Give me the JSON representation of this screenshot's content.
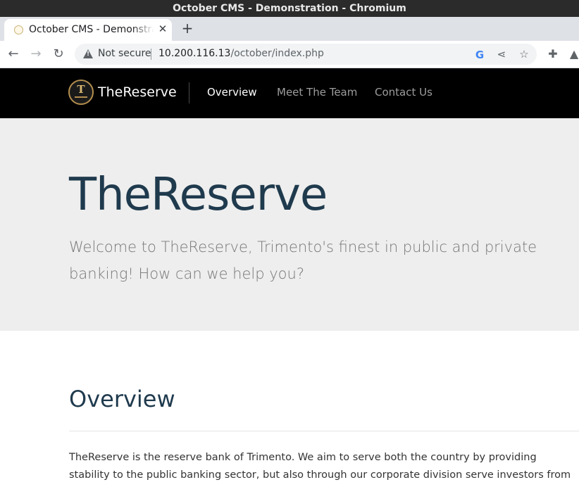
{
  "window": {
    "title": "October CMS - Demonstration - Chromium"
  },
  "tab": {
    "title": "October CMS - Demonstration",
    "close_icon": "close-icon"
  },
  "toolbar": {
    "security_label": "Not secure",
    "url_host": "10.200.116.13",
    "url_path": "/october/index.php"
  },
  "site": {
    "brand": "TheReserve",
    "nav": [
      "Overview",
      "Meet The Team",
      "Contact Us"
    ]
  },
  "hero": {
    "title": "TheReserve",
    "subtitle": "Welcome to TheReserve, Trimento's finest in public and private banking! How can we help you?"
  },
  "overview": {
    "title": "Overview",
    "text": "TheReserve is the reserve bank of Trimento. We aim to serve both the country by providing stability to the public banking sector, but also through our corporate division serve investors from foreign"
  },
  "colors": {
    "navbar_bg": "#000000",
    "hero_bg": "#eeeeee",
    "heading": "#1f3a4d"
  }
}
